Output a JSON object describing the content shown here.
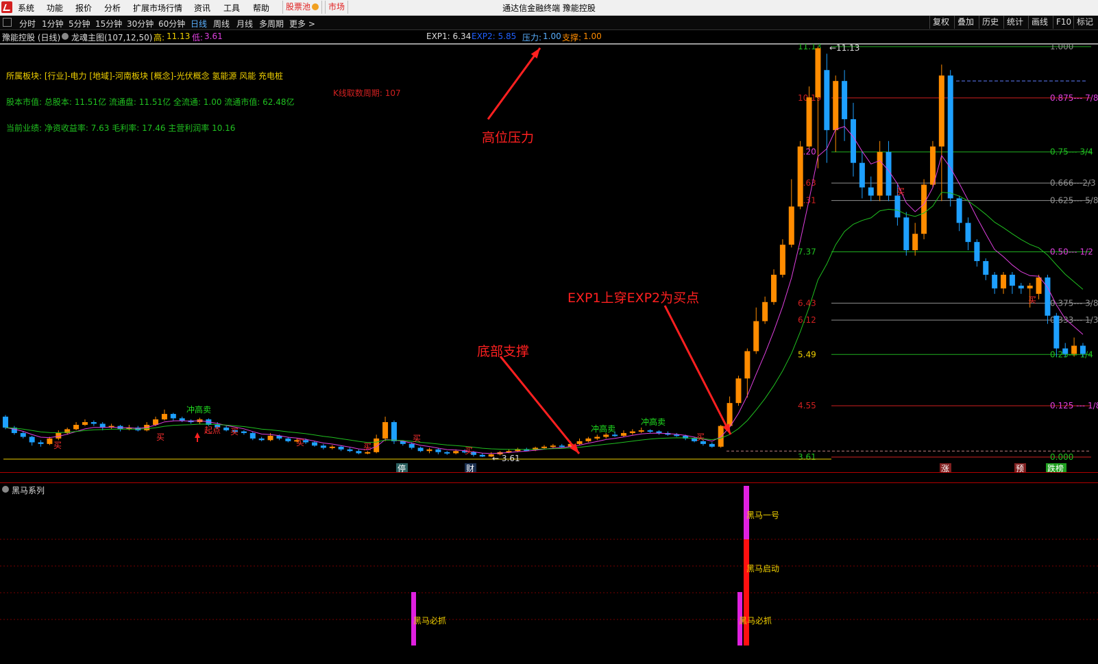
{
  "menu": {
    "items": [
      "系统",
      "功能",
      "报价",
      "分析",
      "扩展市场行情",
      "资讯",
      "工具",
      "帮助"
    ],
    "stock_pool": "股票池",
    "market": "市场"
  },
  "window_title": "通达信金融终端  豫能控股",
  "periods": [
    "分时",
    "1分钟",
    "5分钟",
    "15分钟",
    "30分钟",
    "60分钟",
    "日线",
    "周线",
    "月线",
    "多周期",
    "更多 >"
  ],
  "active_period": "日线",
  "right_buttons": [
    "复权",
    "叠加",
    "历史",
    "统计",
    "画线",
    "F10",
    "标记"
  ],
  "info": {
    "stock": "豫能控股 (日线)",
    "indicator": "龙魂主图(107,12,50)",
    "high_label": "高:",
    "high_value": "11.13",
    "low_label": "低:",
    "low_value": "3.61",
    "exp1": "EXP1: 6.34",
    "exp2": "EXP2: 5.85",
    "pressure_label": "压力:",
    "pressure_value": "1.00",
    "support_label": "支撑:",
    "support_value": "1.00"
  },
  "notes": {
    "sector": "所属板块: [行业]-电力 [地域]-河南板块 [概念]-光伏概念 氢能源 风能 充电桩",
    "market_value": "股本市值: 总股本: 11.51亿 流通盘: 11.51亿 全流通: 1.00 流通市值: 62.48亿",
    "performance": "当前业绩: 净资收益率: 7.63 毛利率: 17.46 主营利润率 10.16",
    "kline_period": "K线取数周期: 107"
  },
  "annotations": {
    "high_pressure": "高位压力",
    "bottom_support": "底部支撑",
    "buy_point": "EXP1上穿EXP2为买点"
  },
  "price_levels": [
    {
      "price": "11.13",
      "ratio": "1.000"
    },
    {
      "price": "10.19",
      "ratio": "0.875--- 7/8"
    },
    {
      "price": "9.20",
      "ratio": "0.75--- 3/4"
    },
    {
      "price": "8.63",
      "ratio": "0.666---2/3"
    },
    {
      "price": "8.31",
      "ratio": "0.625--- 5/8"
    },
    {
      "price": "7.37",
      "ratio": "0.50--- 1/2"
    },
    {
      "price": "6.43",
      "ratio": "0.375--- 3/8"
    },
    {
      "price": "6.12",
      "ratio": "0.333--- 1/3"
    },
    {
      "price": "5.49",
      "ratio": "0.25--- 1/4"
    },
    {
      "price": "4.55",
      "ratio": "0.125 --- 1/8"
    },
    {
      "price": "3.61",
      "ratio": "0.000"
    }
  ],
  "marker_labels": {
    "high_mark": "11.13",
    "low_mark": "3.61",
    "sell_high": "冲高卖",
    "buy": "买",
    "start": "起点"
  },
  "bottom_tags": [
    "停",
    "财",
    "涨",
    "预",
    "跌榜"
  ],
  "panel": {
    "title": "黑马系列",
    "labels": {
      "no1": "黑马一号",
      "start": "黑马启动",
      "must1": "黑马必抓",
      "must2": "黑马必抓"
    }
  },
  "colors": {
    "up": "#ff8c00",
    "down": "#1ea0ff",
    "exp1": "#e040e0",
    "exp2": "#20c020",
    "grid_red": "#d02020",
    "grid_green": "#20b020",
    "grid_gray": "#909090",
    "yellow": "#f0d000"
  },
  "chart_data": {
    "type": "candlestick",
    "ylim": [
      3.61,
      11.13
    ],
    "candles": [
      [
        4.35,
        4.15,
        4.38,
        4.12
      ],
      [
        4.15,
        4.05,
        4.18,
        4.02
      ],
      [
        4.05,
        3.98,
        4.08,
        3.95
      ],
      [
        3.98,
        3.88,
        4.0,
        3.82
      ],
      [
        3.88,
        3.85,
        3.92,
        3.8
      ],
      [
        3.85,
        3.95,
        3.98,
        3.83
      ],
      [
        3.95,
        4.05,
        4.1,
        3.92
      ],
      [
        4.05,
        4.12,
        4.15,
        4.02
      ],
      [
        4.12,
        4.2,
        4.25,
        4.1
      ],
      [
        4.2,
        4.25,
        4.3,
        4.18
      ],
      [
        4.25,
        4.22,
        4.28,
        4.18
      ],
      [
        4.22,
        4.15,
        4.25,
        4.1
      ],
      [
        4.15,
        4.18,
        4.22,
        4.12
      ],
      [
        4.18,
        4.12,
        4.2,
        4.08
      ],
      [
        4.12,
        4.15,
        4.2,
        4.1
      ],
      [
        4.15,
        4.1,
        4.18,
        4.08
      ],
      [
        4.1,
        4.2,
        4.25,
        4.08
      ],
      [
        4.2,
        4.3,
        4.35,
        4.18
      ],
      [
        4.3,
        4.4,
        4.48,
        4.28
      ],
      [
        4.4,
        4.32,
        4.42,
        4.28
      ],
      [
        4.32,
        4.28,
        4.35,
        4.25
      ],
      [
        4.28,
        4.25,
        4.3,
        4.22
      ],
      [
        4.25,
        4.3,
        4.33,
        4.22
      ],
      [
        4.3,
        4.2,
        4.32,
        4.18
      ],
      [
        4.2,
        4.15,
        4.25,
        4.12
      ],
      [
        4.15,
        4.1,
        4.18,
        4.08
      ],
      [
        4.1,
        4.08,
        4.12,
        4.05
      ],
      [
        4.08,
        4.05,
        4.1,
        4.02
      ],
      [
        4.05,
        3.95,
        4.08,
        3.92
      ],
      [
        3.95,
        3.92,
        3.98,
        3.9
      ],
      [
        3.92,
        4.0,
        4.05,
        3.9
      ],
      [
        4.0,
        3.95,
        4.02,
        3.92
      ],
      [
        3.95,
        3.9,
        3.98,
        3.88
      ],
      [
        3.9,
        3.92,
        3.95,
        3.88
      ],
      [
        3.92,
        3.88,
        3.95,
        3.85
      ],
      [
        3.88,
        3.82,
        3.9,
        3.8
      ],
      [
        3.82,
        3.78,
        3.85,
        3.75
      ],
      [
        3.78,
        3.8,
        3.83,
        3.75
      ],
      [
        3.8,
        3.75,
        3.82,
        3.72
      ],
      [
        3.75,
        3.72,
        3.78,
        3.7
      ],
      [
        3.72,
        3.68,
        3.75,
        3.66
      ],
      [
        3.68,
        3.7,
        3.72,
        3.66
      ],
      [
        3.7,
        3.95,
        4.02,
        3.68
      ],
      [
        3.95,
        4.25,
        4.35,
        3.9
      ],
      [
        4.25,
        3.9,
        4.28,
        3.85
      ],
      [
        3.9,
        3.85,
        3.92,
        3.82
      ],
      [
        3.85,
        3.78,
        3.88,
        3.75
      ],
      [
        3.78,
        3.72,
        3.8,
        3.7
      ],
      [
        3.72,
        3.75,
        3.78,
        3.68
      ],
      [
        3.75,
        3.7,
        3.78,
        3.66
      ],
      [
        3.7,
        3.68,
        3.72,
        3.65
      ],
      [
        3.68,
        3.72,
        3.75,
        3.66
      ],
      [
        3.72,
        3.7,
        3.75,
        3.68
      ],
      [
        3.7,
        3.65,
        3.72,
        3.62
      ],
      [
        3.65,
        3.62,
        3.68,
        3.61
      ],
      [
        3.62,
        3.66,
        3.7,
        3.61
      ],
      [
        3.66,
        3.7,
        3.72,
        3.64
      ],
      [
        3.7,
        3.72,
        3.75,
        3.68
      ],
      [
        3.72,
        3.75,
        3.78,
        3.7
      ],
      [
        3.75,
        3.74,
        3.78,
        3.72
      ],
      [
        3.74,
        3.78,
        3.8,
        3.72
      ],
      [
        3.78,
        3.8,
        3.83,
        3.76
      ],
      [
        3.8,
        3.82,
        3.85,
        3.78
      ],
      [
        3.82,
        3.8,
        3.85,
        3.78
      ],
      [
        3.8,
        3.85,
        3.9,
        3.78
      ],
      [
        3.85,
        3.9,
        3.95,
        3.83
      ],
      [
        3.9,
        3.95,
        3.98,
        3.88
      ],
      [
        3.95,
        3.98,
        4.02,
        3.92
      ],
      [
        3.98,
        4.02,
        4.05,
        3.95
      ],
      [
        4.02,
        4.0,
        4.08,
        3.98
      ],
      [
        4.0,
        4.05,
        4.1,
        3.98
      ],
      [
        4.05,
        4.08,
        4.12,
        4.02
      ],
      [
        4.08,
        4.1,
        4.15,
        4.05
      ],
      [
        4.1,
        4.08,
        4.12,
        4.05
      ],
      [
        4.08,
        4.05,
        4.1,
        4.02
      ],
      [
        4.05,
        4.02,
        4.08,
        4.0
      ],
      [
        4.02,
        4.0,
        4.05,
        3.98
      ],
      [
        4.0,
        3.95,
        4.02,
        3.92
      ],
      [
        3.95,
        3.9,
        3.98,
        3.88
      ],
      [
        3.9,
        3.85,
        3.92,
        3.82
      ],
      [
        3.85,
        3.8,
        3.88,
        3.78
      ],
      [
        3.8,
        4.18,
        4.2,
        3.78
      ],
      [
        4.18,
        4.6,
        4.72,
        4.15
      ],
      [
        4.6,
        5.05,
        5.1,
        4.55
      ],
      [
        5.05,
        5.55,
        5.6,
        4.7
      ],
      [
        5.55,
        6.1,
        6.35,
        5.5
      ],
      [
        6.1,
        6.45,
        6.55,
        6.05
      ],
      [
        6.45,
        6.95,
        7.05,
        6.4
      ],
      [
        6.95,
        7.5,
        7.6,
        6.9
      ],
      [
        7.5,
        8.2,
        8.7,
        7.45
      ],
      [
        8.2,
        9.3,
        9.4,
        8.15
      ],
      [
        9.3,
        10.2,
        10.4,
        9.25
      ],
      [
        10.2,
        11.1,
        11.13,
        8.9
      ],
      [
        10.7,
        9.6,
        11.0,
        9.0
      ],
      [
        9.6,
        10.5,
        10.6,
        9.2
      ],
      [
        10.5,
        9.8,
        10.7,
        9.4
      ],
      [
        9.8,
        9.0,
        10.1,
        8.75
      ],
      [
        9.0,
        8.55,
        9.2,
        8.35
      ],
      [
        8.55,
        8.4,
        8.75,
        8.3
      ],
      [
        8.4,
        9.2,
        9.4,
        8.3
      ],
      [
        9.2,
        8.4,
        9.4,
        8.3
      ],
      [
        8.4,
        8.0,
        8.6,
        7.85
      ],
      [
        8.0,
        7.4,
        8.1,
        7.3
      ],
      [
        7.4,
        7.7,
        7.9,
        7.3
      ],
      [
        7.7,
        8.6,
        8.7,
        7.6
      ],
      [
        8.6,
        9.3,
        9.4,
        8.55
      ],
      [
        9.3,
        10.6,
        10.8,
        8.3
      ],
      [
        10.6,
        8.35,
        10.7,
        8.2
      ],
      [
        8.35,
        7.9,
        8.4,
        7.75
      ],
      [
        7.9,
        7.55,
        8.0,
        7.4
      ],
      [
        7.55,
        7.2,
        7.6,
        7.1
      ],
      [
        7.2,
        6.95,
        7.25,
        6.85
      ],
      [
        6.95,
        6.7,
        7.0,
        6.6
      ],
      [
        6.7,
        6.95,
        7.0,
        6.6
      ],
      [
        6.95,
        6.75,
        7.0,
        6.6
      ],
      [
        6.75,
        6.7,
        6.8,
        6.6
      ],
      [
        6.7,
        6.75,
        6.8,
        6.35
      ],
      [
        6.6,
        6.9,
        6.95,
        6.5
      ],
      [
        6.9,
        6.2,
        6.95,
        6.05
      ],
      [
        6.2,
        5.6,
        6.25,
        5.45
      ],
      [
        5.6,
        5.5,
        5.7,
        5.45
      ],
      [
        5.5,
        5.65,
        5.8,
        5.45
      ],
      [
        5.65,
        5.5,
        5.7,
        5.45
      ]
    ]
  }
}
